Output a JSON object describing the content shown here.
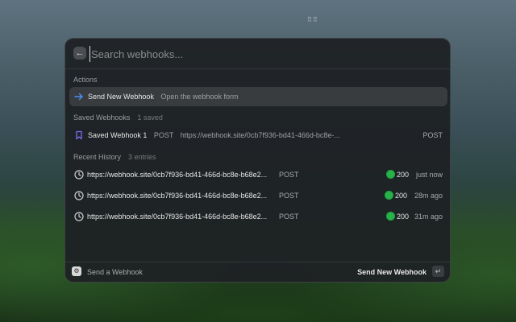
{
  "search": {
    "placeholder": "Search webhooks..."
  },
  "sections": {
    "actions": {
      "title": "Actions"
    },
    "saved": {
      "title": "Saved Webhooks",
      "count": "1 saved"
    },
    "history": {
      "title": "Recent History",
      "count": "3 entries"
    }
  },
  "actions": [
    {
      "label": "Send New Webhook",
      "description": "Open the webhook form",
      "icon": "arrow-right-icon"
    }
  ],
  "saved": [
    {
      "name": "Saved Webhook 1",
      "method": "POST",
      "url": "https://webhook.site/0cb7f936-bd41-466d-bc8e-...",
      "method_right": "POST",
      "icon": "bookmark-icon"
    }
  ],
  "history": [
    {
      "url": "https://webhook.site/0cb7f936-bd41-466d-bc8e-b68e2...",
      "method": "POST",
      "status": "200",
      "time": "just now",
      "icon": "clock-icon"
    },
    {
      "url": "https://webhook.site/0cb7f936-bd41-466d-bc8e-b68e2...",
      "method": "POST",
      "status": "200",
      "time": "28m ago",
      "icon": "clock-icon"
    },
    {
      "url": "https://webhook.site/0cb7f936-bd41-466d-bc8e-b68e2...",
      "method": "POST",
      "status": "200",
      "time": "31m ago",
      "icon": "clock-icon"
    }
  ],
  "footer": {
    "label": "Send a Webhook",
    "action": "Send New Webhook",
    "enter_key": "↵"
  },
  "colors": {
    "accent": "#4f8ff7",
    "bookmark": "#7b6cf6",
    "status_ok": "#27b34a"
  }
}
